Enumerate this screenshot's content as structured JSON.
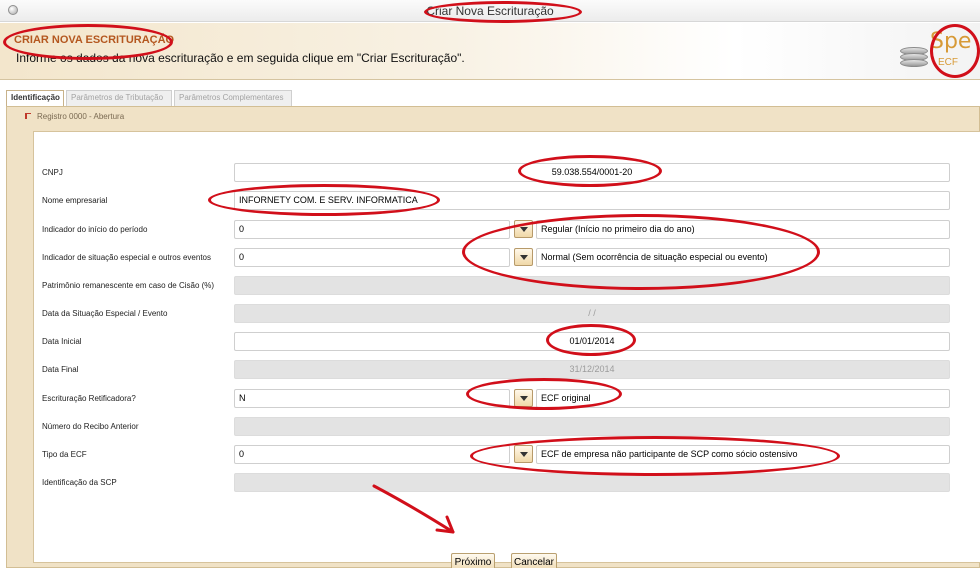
{
  "window": {
    "title": "Criar Nova Escrituração"
  },
  "header": {
    "title": "CRIAR NOVA ESCRITURAÇÃO",
    "subtitle": "Informe os dados da nova escrituração e em seguida clique em \"Criar Escrituração\".",
    "logo_text": "Spe",
    "logo_sub": "ECF"
  },
  "tabs": [
    {
      "label": "Identificação",
      "active": true
    },
    {
      "label": "Parâmetros de Tributação",
      "active": false
    },
    {
      "label": "Parâmetros Complementares",
      "active": false
    }
  ],
  "section": {
    "title": "Registro 0000 - Abertura"
  },
  "form": {
    "cnpj": {
      "label": "CNPJ",
      "value": "59.038.554/0001-20"
    },
    "nome": {
      "label": "Nome empresarial",
      "value": "INFORNETY COM. E SERV. INFORMATICA"
    },
    "indicador_inicio": {
      "label": "Indicador do início do período",
      "code": "0",
      "description": "Regular (Início no primeiro dia do ano)"
    },
    "indicador_situacao": {
      "label": "Indicador de situação especial e outros eventos",
      "code": "0",
      "description": "Normal (Sem ocorrência de situação especial ou evento)"
    },
    "patrimonio": {
      "label": "Patrimônio remanescente em caso de Cisão (%)",
      "value": ""
    },
    "data_situacao": {
      "label": "Data da Situação Especial / Evento",
      "value": "/ /"
    },
    "data_inicial": {
      "label": "Data Inicial",
      "value": "01/01/2014"
    },
    "data_final": {
      "label": "Data Final",
      "value": "31/12/2014"
    },
    "retificadora": {
      "label": "Escrituração Retificadora?",
      "code": "N",
      "description": "ECF original"
    },
    "recibo": {
      "label": "Número do Recibo Anterior",
      "value": ""
    },
    "tipo_ecf": {
      "label": "Tipo da ECF",
      "code": "0",
      "description": "ECF de empresa não participante de SCP como sócio ostensivo"
    },
    "scp": {
      "label": "Identificação da SCP",
      "value": ""
    }
  },
  "buttons": {
    "next": "Próximo",
    "cancel": "Cancelar"
  },
  "colors": {
    "annotation": "#d10f1a",
    "header_title": "#b4571f",
    "panel": "#f0e2c6"
  }
}
